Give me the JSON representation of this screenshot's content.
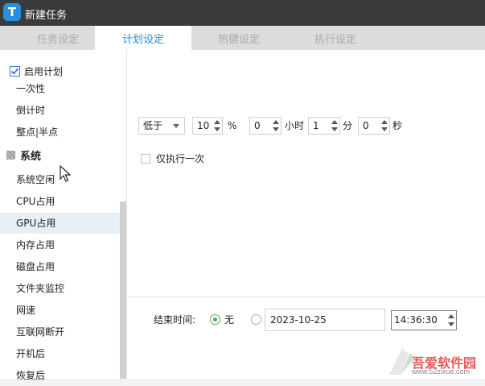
{
  "window": {
    "title": "新建任务",
    "app_icon_letter": "T"
  },
  "tabs": [
    {
      "label": "任务设定",
      "active": false
    },
    {
      "label": "计划设定",
      "active": true
    },
    {
      "label": "热键设定",
      "active": false
    },
    {
      "label": "执行设定",
      "active": false
    }
  ],
  "sidebar": {
    "enable_plan": {
      "label": "启用计划",
      "checked": true
    },
    "items_top": [
      "一次性",
      "倒计时",
      "整点|半点"
    ],
    "group": {
      "label": "系统"
    },
    "items_system": [
      "系统空闲",
      "CPU占用",
      "GPU占用",
      "内存占用",
      "磁盘占用",
      "文件夹监控",
      "网速",
      "互联网断开",
      "开机后",
      "恢复后"
    ],
    "hovered_item": "GPU占用"
  },
  "condition": {
    "comparator": "低于",
    "percent_value": "10",
    "percent_unit": "%",
    "hours_value": "0",
    "hours_unit": "小时",
    "minutes_value": "1",
    "minutes_unit": "分",
    "seconds_value": "0",
    "seconds_unit": "秒"
  },
  "run_once": {
    "label": "仅执行一次",
    "checked": false
  },
  "end_time": {
    "label": "结束时间:",
    "none_label": "无",
    "none_selected": true,
    "date_value": "2023-10-25",
    "time_value": "14:36:30"
  },
  "watermark": {
    "text": "吾爱软件园",
    "url": "www.52zixue.com"
  },
  "colors": {
    "accent": "#2b8ed8",
    "titlebar": "#3a3a3a",
    "radio_on": "#4caf50"
  }
}
